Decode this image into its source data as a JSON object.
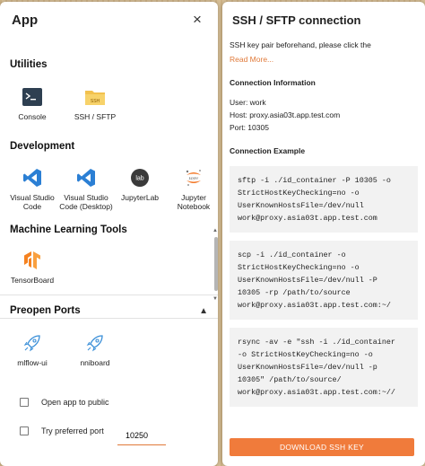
{
  "app_panel": {
    "title": "App",
    "close_icon": "×",
    "sections": {
      "utilities": {
        "title": "Utilities",
        "apps": [
          {
            "label": "Console",
            "icon": "terminal-icon"
          },
          {
            "label": "SSH / SFTP",
            "icon": "folder-ssh-icon"
          }
        ]
      },
      "development": {
        "title": "Development",
        "apps": [
          {
            "label": "Visual Studio Code",
            "icon": "vscode-icon"
          },
          {
            "label": "Visual Studio Code (Desktop)",
            "icon": "vscode-icon"
          },
          {
            "label": "JupyterLab",
            "icon": "jupyterlab-icon"
          },
          {
            "label": "Jupyter Notebook",
            "icon": "jupyter-icon"
          }
        ]
      },
      "ml_tools": {
        "title": "Machine Learning Tools",
        "apps": [
          {
            "label": "TensorBoard",
            "icon": "tensorboard-icon"
          }
        ]
      },
      "preopen_ports": {
        "title": "Preopen Ports",
        "apps": [
          {
            "label": "mlflow-ui",
            "icon": "rocket-icon"
          },
          {
            "label": "nniboard",
            "icon": "rocket-icon"
          }
        ]
      }
    },
    "options": {
      "open_public_label": "Open app to public",
      "preferred_port_label": "Try preferred port",
      "preferred_port_value": "10250"
    }
  },
  "ssh_panel": {
    "title": "SSH / SFTP connection",
    "intro": "SSH key pair beforehand, please click the",
    "read_more": "Read More...",
    "connection_info_title": "Connection Information",
    "user": "User: work",
    "host": "Host: proxy.asia03t.app.test.com",
    "port": "Port: 10305",
    "connection_example_title": "Connection Example",
    "examples": [
      "sftp -i ./id_container -P 10305 -o\nStrictHostKeyChecking=no -o\nUserKnownHostsFile=/dev/null\nwork@proxy.asia03t.app.test.com",
      "scp -i ./id_container -o\nStrictHostKeyChecking=no -o\nUserKnownHostsFile=/dev/null -P\n10305 -rp /path/to/source\nwork@proxy.asia03t.app.test.com:~/",
      "rsync -av -e \"ssh -i ./id_container\n-o StrictHostKeyChecking=no -o\nUserKnownHostsFile=/dev/null -p\n10305\" /path/to/source/\nwork@proxy.asia03t.app.test.com:~//"
    ],
    "download_button": "DOWNLOAD SSH KEY"
  },
  "colors": {
    "accent": "#f07b3b",
    "vscode_blue": "#2b7fd4",
    "tensorboard_orange": "#f58220"
  }
}
